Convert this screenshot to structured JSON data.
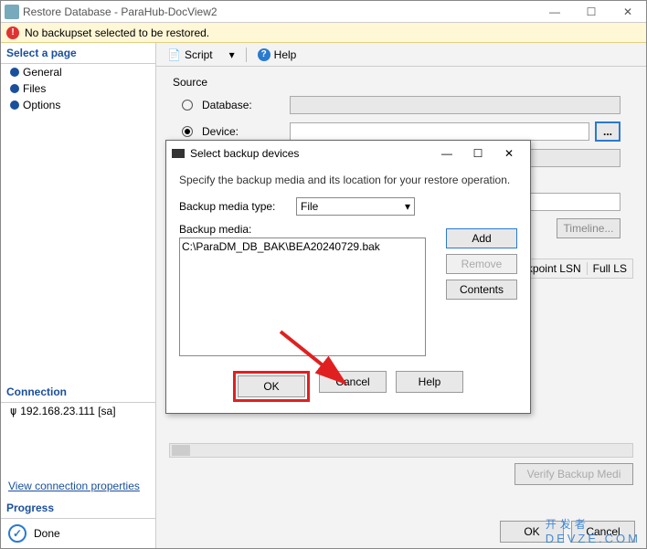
{
  "window": {
    "title": "Restore Database - ParaHub-DocView2",
    "min": "—",
    "max": "☐",
    "close": "✕"
  },
  "warning": {
    "icon": "!",
    "text": "No backupset selected to be restored."
  },
  "left": {
    "select_page": "Select a page",
    "items": [
      "General",
      "Files",
      "Options"
    ],
    "connection_hdr": "Connection",
    "connection_value": "192.168.23.111 [sa]",
    "view_props": "View connection properties",
    "progress_hdr": "Progress",
    "progress_status": "Done",
    "progress_check": "✓"
  },
  "toolbar": {
    "script": "Script",
    "drop": "▾",
    "help": "Help"
  },
  "source": {
    "group": "Source",
    "database_label": "Database:",
    "device_label": "Device:",
    "database2_label": "Database:",
    "browse": "...",
    "selected": "device"
  },
  "destination": {
    "timeline": "Timeline..."
  },
  "grid": {
    "cols": [
      "LSN",
      "Checkpoint LSN",
      "Full LS"
    ]
  },
  "footer": {
    "ok": "OK",
    "cancel": "Cancel",
    "verify": "Verify Backup Medi"
  },
  "modal": {
    "title": "Select backup devices",
    "min": "—",
    "max": "☐",
    "close": "✕",
    "desc": "Specify the backup media and its location for your restore operation.",
    "media_type_label": "Backup media type:",
    "media_type_value": "File",
    "media_label": "Backup media:",
    "media_item": "C:\\ParaDM_DB_BAK\\BEA20240729.bak",
    "add": "Add",
    "remove": "Remove",
    "contents": "Contents",
    "ok": "OK",
    "cancel": "Cancel",
    "help": "Help"
  },
  "watermark": {
    "big": "开发者",
    "sub": "DEVZE.COM"
  }
}
